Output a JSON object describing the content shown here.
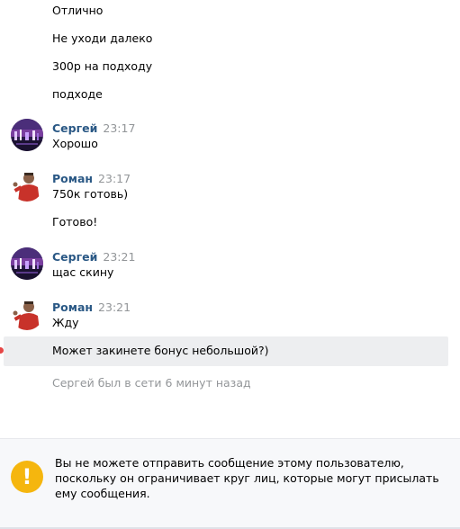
{
  "messages": {
    "m1": "Отлично",
    "m2": "Не уходи далеко",
    "m3": "300р на подходу",
    "m4": "подходе",
    "m5": "Хорошо",
    "m6": "750к готовь)",
    "m7": "Готово!",
    "m8": "щас скину",
    "m9": "Жду",
    "m10": "Может закинете бонус небольшой?)"
  },
  "groups": {
    "g1": {
      "author": "Сергей",
      "time": "23:17"
    },
    "g2": {
      "author": "Роман",
      "time": "23:17"
    },
    "g3": {
      "author": "Сергей",
      "time": "23:21"
    },
    "g4": {
      "author": "Роман",
      "time": "23:21"
    }
  },
  "status_text": "Сергей был в сети 6 минут назад",
  "notice": {
    "icon": "!",
    "text": "Вы не можете отправить сообщение этому пользователю, поскольку он ограничивает круг лиц, которые могут присылать ему сообщения."
  },
  "colors": {
    "author": "#2a5885",
    "time": "#939699",
    "highlight": "#edeef0",
    "warning": "#f5b60e"
  }
}
